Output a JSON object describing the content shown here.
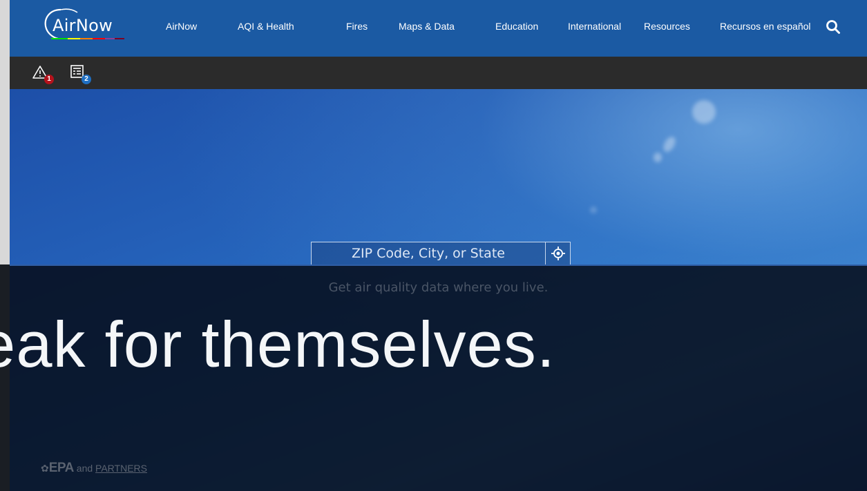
{
  "navbar": {
    "logo_text": "AirNow",
    "items": [
      {
        "label": "AirNow"
      },
      {
        "label": "AQI & Health"
      },
      {
        "label": "Fires"
      },
      {
        "label": "Maps & Data"
      },
      {
        "label": "Education"
      },
      {
        "label": "International"
      },
      {
        "label": "Resources"
      },
      {
        "label": "Recursos en español"
      }
    ]
  },
  "subbar": {
    "alerts_count": "1",
    "notices_count": "2"
  },
  "search": {
    "placeholder": "ZIP Code, City, or State"
  },
  "hero": {
    "tagline": "Get air quality data where you live."
  },
  "footer": {
    "epa_mark": "EPA",
    "and_text": "and",
    "partners_link": "PARTNERS"
  },
  "caption": {
    "text": "eak for themselves."
  },
  "colors": {
    "nav_bg": "#1b5aa3",
    "subbar_bg": "#2b2b2b",
    "alert_badge": "#b5121b",
    "notice_badge": "#1f6fc2"
  }
}
